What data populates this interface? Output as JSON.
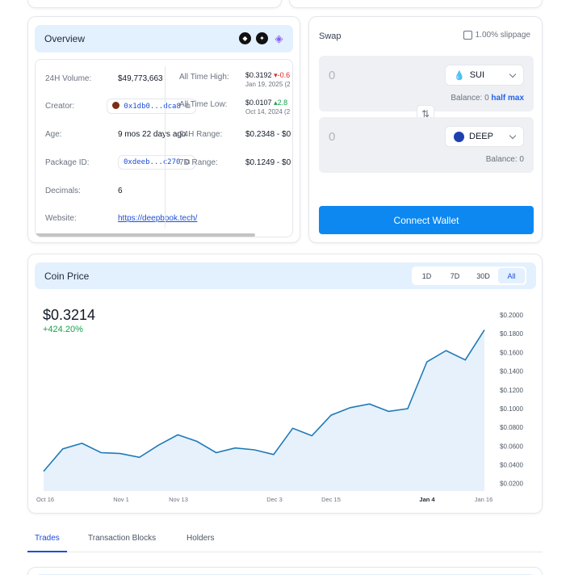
{
  "overview": {
    "title": "Overview",
    "socials": [
      "social-icon-1",
      "social-icon-2",
      "social-icon-3"
    ],
    "left_rows": [
      {
        "label": "24H Volume:",
        "value": "$49,773,663"
      },
      {
        "label": "Creator:",
        "value": "0x1db0...dca8"
      },
      {
        "label": "Age:",
        "value": "9 mos 22 days ago"
      },
      {
        "label": "Package ID:",
        "value": "0xdeeb...c270"
      },
      {
        "label": "Decimals:",
        "value": "6"
      },
      {
        "label": "Website:",
        "value": "https://deepbook.tech/"
      }
    ],
    "right_rows": [
      {
        "label": "All Time High:",
        "value": "$0.3192",
        "change": "-0.6",
        "date": "Jan 19, 2025 (2"
      },
      {
        "label": "All Time Low:",
        "value": "$0.0107",
        "change": "2.8",
        "date": "Oct 14, 2024 (2"
      },
      {
        "label": "24H Range:",
        "value": "$0.2348 - $0"
      },
      {
        "label": "7D Range:",
        "value": "$0.1249 - $0"
      }
    ]
  },
  "swap": {
    "title": "Swap",
    "slippage": "1.00% slippage",
    "from": {
      "amount": "0",
      "token": "SUI",
      "balance_label": "Balance: 0",
      "half": "half",
      "max": "max"
    },
    "to": {
      "amount": "0",
      "token": "DEEP",
      "balance_label": "Balance: 0"
    },
    "connect_label": "Connect Wallet"
  },
  "coin_price": {
    "title": "Coin Price",
    "ranges": [
      "1D",
      "7D",
      "30D",
      "All"
    ],
    "active_range": "All",
    "price": "$0.3214",
    "change": "+424.20%"
  },
  "chart_data": {
    "type": "area",
    "x_tick_labels": [
      "Oct 16",
      "Nov 1",
      "Nov 13",
      "Dec 3",
      "Dec 15",
      "Jan 4",
      "Jan 16"
    ],
    "y_tick_labels": [
      "$0.2000",
      "$0.1800",
      "$0.1600",
      "$0.1400",
      "$0.1200",
      "$0.1000",
      "$0.0800",
      "$0.0600",
      "$0.0400",
      "$0.0200"
    ],
    "ylim": [
      0.012,
      0.2
    ],
    "values": [
      0.033,
      0.057,
      0.063,
      0.053,
      0.052,
      0.048,
      0.061,
      0.072,
      0.065,
      0.053,
      0.058,
      0.056,
      0.051,
      0.079,
      0.071,
      0.093,
      0.101,
      0.105,
      0.097,
      0.1,
      0.15,
      0.162,
      0.152,
      0.184
    ],
    "color": "#1f7ab8",
    "fill": "#e7f1fb",
    "grid": false
  },
  "tabs": [
    "Trades",
    "Transaction Blocks",
    "Holders"
  ],
  "active_tab": "Trades"
}
